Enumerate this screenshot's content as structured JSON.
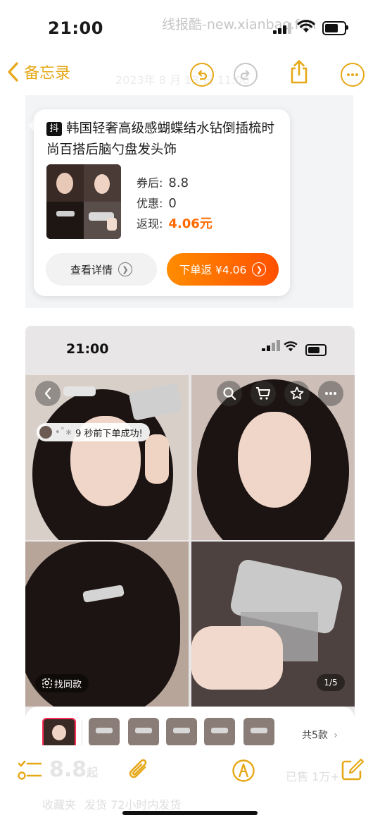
{
  "status_bar": {
    "time": "21:00",
    "watermark": "线报酷-new.xianbao.fun"
  },
  "nav": {
    "back_label": "备忘录",
    "faded_date": "2023年 8 月 13 日 11:00"
  },
  "product_card": {
    "platform_badge": "抖",
    "title": "韩国轻奢高级感蝴蝶结水钻倒插梳时尚百搭后脑勺盘发头饰",
    "coupon_label": "券后:",
    "coupon_value": "8.8",
    "discount_label": "优惠:",
    "discount_value": "0",
    "rebate_label": "返现:",
    "rebate_value": "4.06元",
    "detail_button": "查看详情",
    "order_button": "下单返 ¥4.06"
  },
  "embedded_screenshot": {
    "time": "21:00",
    "notice": "9 秒前下单成功!",
    "find_similar": "找同款",
    "page_counter": "1/5",
    "thumb_total": "共5款",
    "thumb_count": 6
  },
  "faded_note": {
    "price": "8.8",
    "price_unit": "起",
    "right_label": "已售 1万+",
    "line1": "收藏夹",
    "line2": "发货 72小时内发货"
  },
  "toolbar": {
    "icons": [
      "checklist-icon",
      "paperclip-icon",
      "markup-icon",
      "compose-icon"
    ]
  },
  "colors": {
    "accent": "#e6a817",
    "order_gradient_start": "#ff8c00",
    "order_gradient_end": "#ff5000",
    "rebate": "#ff6a00"
  }
}
